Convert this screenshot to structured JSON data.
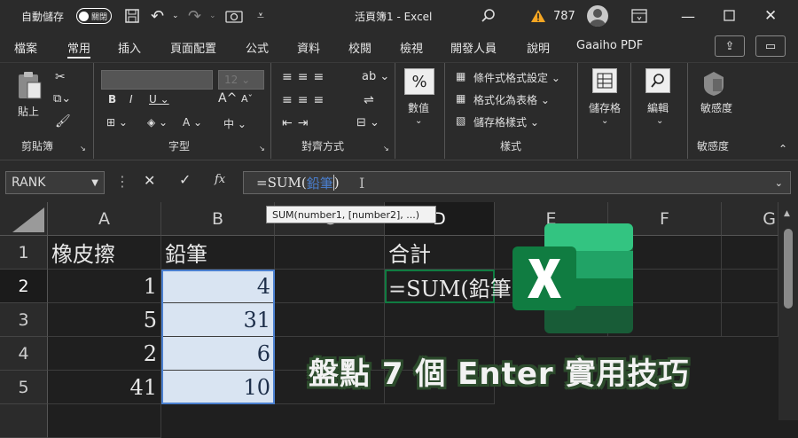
{
  "titlebar": {
    "autosave_label": "自動儲存",
    "autosave_state": "關閉",
    "doc_title": "活頁簿1  -  Excel",
    "warning_count": "787"
  },
  "tabs": [
    "檔案",
    "常用",
    "插入",
    "頁面配置",
    "公式",
    "資料",
    "校閱",
    "檢視",
    "開發人員",
    "說明",
    "Gaaiho PDF"
  ],
  "ribbon": {
    "clipboard": {
      "paste": "貼上",
      "label": "剪貼簿"
    },
    "font": {
      "size": "12",
      "label": "字型"
    },
    "alignment": {
      "label": "對齊方式"
    },
    "number": {
      "button": "數值",
      "label": ""
    },
    "styles": {
      "conditional": "條件式格式設定",
      "table": "格式化為表格",
      "cellstyle": "儲存格樣式",
      "label": "樣式"
    },
    "cells": {
      "button": "儲存格"
    },
    "editing": {
      "button": "編輯"
    },
    "sensitivity": {
      "button": "敏感度",
      "label": "敏感度"
    }
  },
  "formula_bar": {
    "name_box": "RANK",
    "formula_prefix": "=SUM(",
    "formula_ref": "鉛筆",
    "formula_suffix": ")"
  },
  "tooltip": "SUM(number1, [number2], ...)",
  "columns": [
    "A",
    "B",
    "C",
    "D",
    "E",
    "F",
    "G"
  ],
  "rows": [
    "1",
    "2",
    "3",
    "4",
    "5"
  ],
  "cells": {
    "A1": "橡皮擦",
    "B1": "鉛筆",
    "D1": "合計",
    "A2": "1",
    "B2": "4",
    "D2": "=SUM(鉛筆",
    "A3": "5",
    "B3": "31",
    "A4": "2",
    "B4": "6",
    "A5": "41",
    "B5": "10"
  },
  "banner": "盤點 7 個 Enter 實用技巧",
  "colors": {
    "excel_green": "#107c41",
    "selection_blue": "#d9e4f2",
    "ref_blue": "#4a7fcf"
  }
}
